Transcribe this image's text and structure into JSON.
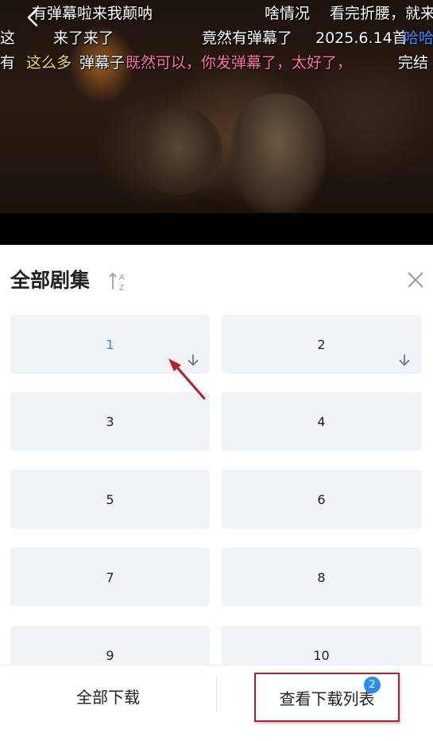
{
  "video": {
    "danmaku_rows": [
      [
        {
          "text": "有弹幕啦来我颠呐",
          "color": "white"
        },
        {
          "text": "啥情况",
          "color": "white"
        },
        {
          "text": "看完折腰，就来",
          "color": "white"
        }
      ],
      [
        {
          "text": "这",
          "color": "white"
        },
        {
          "text": "来了来了",
          "color": "white"
        },
        {
          "text": "竟然有弹幕了",
          "color": "white"
        },
        {
          "text": "2025.6.14首",
          "color": "white"
        },
        {
          "text": "哈哈",
          "color": "blue"
        }
      ],
      [
        {
          "text": "有",
          "color": "white"
        },
        {
          "text": "这么多",
          "color": "yellow"
        },
        {
          "text": "弹幕子",
          "color": "white"
        },
        {
          "text": "既然可以，你发弹幕了，太好了，",
          "color": "pink"
        },
        {
          "text": "完结",
          "color": "white"
        }
      ]
    ]
  },
  "panel": {
    "title": "全部剧集",
    "sort_icon": "sort-az-icon",
    "close_icon": "close-icon",
    "episodes": [
      {
        "label": "1",
        "active": true,
        "download_icon": true
      },
      {
        "label": "2",
        "active": false,
        "download_icon": true
      },
      {
        "label": "3",
        "active": false,
        "download_icon": false
      },
      {
        "label": "4",
        "active": false,
        "download_icon": false
      },
      {
        "label": "5",
        "active": false,
        "download_icon": false
      },
      {
        "label": "6",
        "active": false,
        "download_icon": false
      },
      {
        "label": "7",
        "active": false,
        "download_icon": false
      },
      {
        "label": "8",
        "active": false,
        "download_icon": false
      },
      {
        "label": "9",
        "active": false,
        "download_icon": false
      },
      {
        "label": "10",
        "active": false,
        "download_icon": false
      }
    ]
  },
  "bottom": {
    "download_all_label": "全部下载",
    "view_list_label": "查看下载列表",
    "badge_count": "2"
  },
  "colors": {
    "accent": "#2a8cf0",
    "annotation": "#b3222a",
    "tile_bg": "#f0f3f8"
  }
}
